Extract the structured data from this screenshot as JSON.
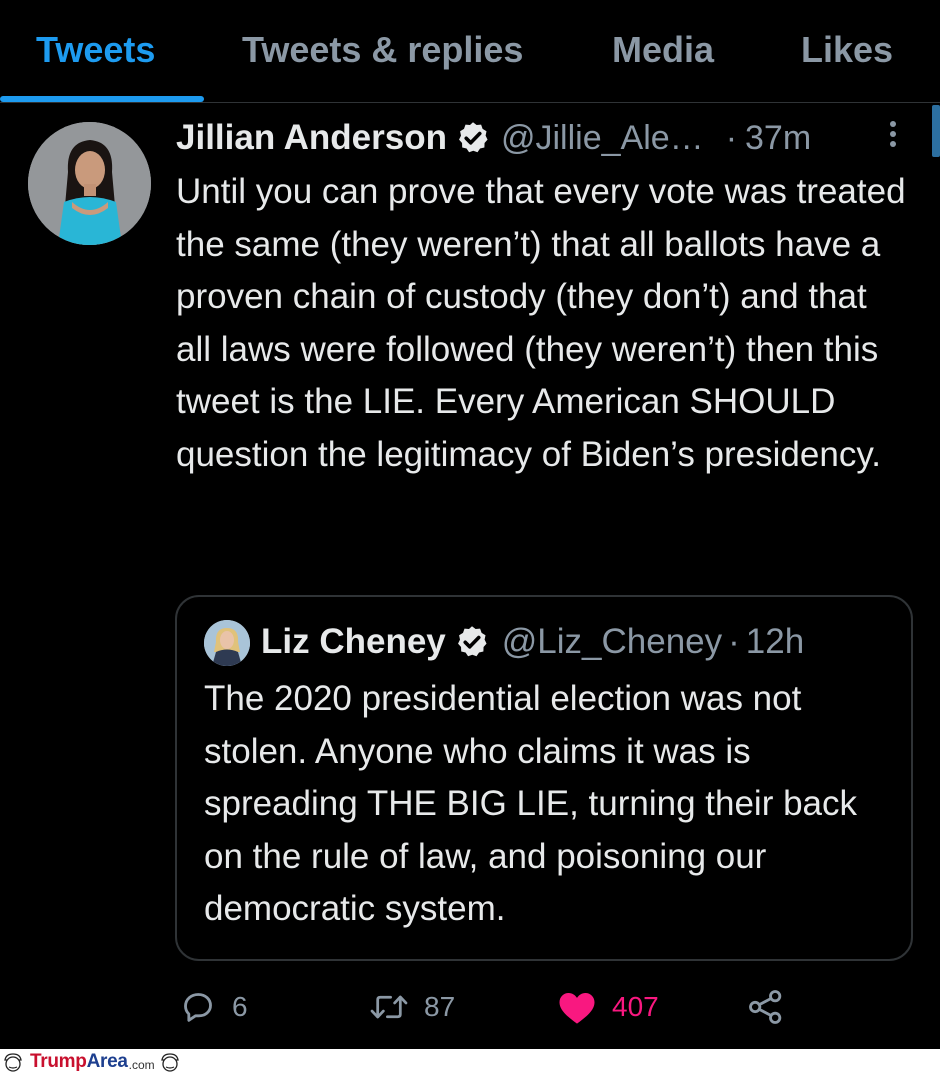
{
  "tabs": [
    {
      "label": "Tweets",
      "active": true
    },
    {
      "label": "Tweets & replies",
      "active": false
    },
    {
      "label": "Media",
      "active": false
    },
    {
      "label": "Likes",
      "active": false
    }
  ],
  "tweet": {
    "author_name": "Jillian Anderson",
    "handle": "@Jillie_Ale…",
    "separator": "·",
    "time": "37m",
    "text": "Until you can prove that every vote was treated the same (they weren’t) that all ballots have a proven chain of custody (they don’t) and that all laws were followed (they weren’t) then this tweet is the LIE. Every American SHOULD question the legitimacy of Biden’s presidency.",
    "verified_icon": "verified-badge-icon",
    "more_icon": "more-options-icon"
  },
  "quoted_tweet": {
    "author_name": "Liz Cheney",
    "handle": "@Liz_Cheney",
    "separator": "·",
    "time": "12h",
    "text": "The 2020 presidential election was not stolen. Anyone who claims it was is spreading THE BIG LIE, turning their back on the rule of law, and poisoning our democratic system."
  },
  "actions": {
    "reply_count": "6",
    "retweet_count": "87",
    "like_count": "407",
    "liked": true,
    "like_color": "#f91880"
  },
  "colors": {
    "accent": "#1d9bf0",
    "background": "#000000",
    "muted": "#8b98a5"
  },
  "watermark": {
    "brand_part1": "Trump",
    "brand_part2": "Area",
    "tld": ".com"
  }
}
